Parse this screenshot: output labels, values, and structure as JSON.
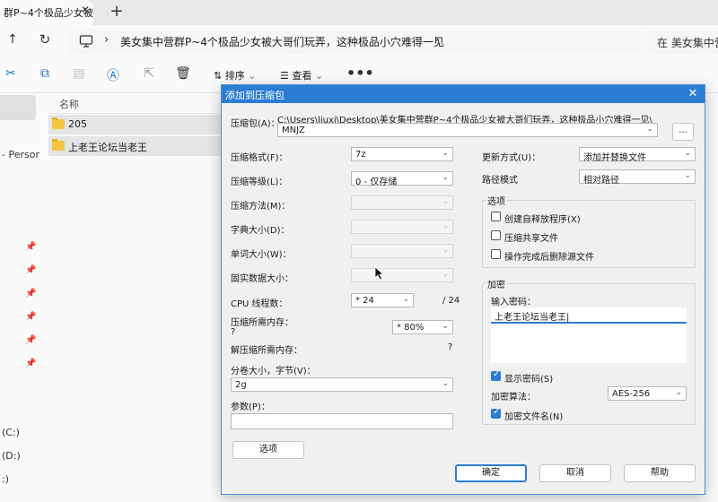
{
  "browser": {
    "tab_title": "群P~4个极品少女被",
    "tab_close": "✕",
    "new_tab": "+"
  },
  "address": {
    "path_text": "美女集中营群P~4个极品少女被大哥们玩弄，这种极品小穴难得一见",
    "search_placeholder": "在 美女集中营"
  },
  "toolbar": {
    "sort_label": "排序",
    "view_label": "查看",
    "more": "•••"
  },
  "sidebar": {
    "person_label": "- Person",
    "drive_c": "(C:)",
    "drive_d": "(D:)",
    "drive_e": ":)"
  },
  "files": {
    "column_name": "名称",
    "items": [
      {
        "name": "205"
      },
      {
        "name": "上老王论坛当老王"
      }
    ]
  },
  "dialog": {
    "title": "添加到压缩包",
    "archive_label": "压缩包(A)：",
    "archive_path": "C:\\Users\\liuxi\\Desktop\\美女集中营群P~4个极品少女被大哥们玩弄，这种极品小穴难得一见\\",
    "archive_name": "MNJZ",
    "browse": "...",
    "format_label": "压缩格式(F)：",
    "format_value": "7z",
    "level_label": "压缩等级(L)：",
    "level_value": "0 - 仅存储",
    "method_label": "压缩方法(M)：",
    "dict_label": "字典大小(D)：",
    "word_label": "单词大小(W)：",
    "solid_label": "固实数据大小：",
    "cpu_label": "CPU 线程数：",
    "cpu_value": "* 24",
    "cpu_total": "/ 24",
    "mem_label": "压缩所需内存：",
    "mem_q": "?",
    "mem_value": "* 80%",
    "decomp_label": "解压缩所需内存：",
    "decomp_q": "?",
    "split_label": "分卷大小，字节(V)：",
    "split_value": "2g",
    "params_label": "参数(P)：",
    "options_button": "选项",
    "update_label": "更新方式(U)：",
    "update_value": "添加并替换文件",
    "pathmode_label": "路径模式",
    "pathmode_value": "相对路径",
    "options_group": "选项",
    "opt_sfx": "创建自释放程序(X)",
    "opt_shared": "压缩共享文件",
    "opt_delete": "操作完成后删除源文件",
    "encrypt_group": "加密",
    "pwd_label": "输入密码：",
    "pwd_value": "上老王论坛当老王|",
    "show_pwd": "显示密码(S)",
    "enc_method_label": "加密算法：",
    "enc_method_value": "AES-256",
    "enc_names": "加密文件名(N)",
    "ok": "确定",
    "cancel": "取消",
    "help": "帮助",
    "close": "✕"
  }
}
